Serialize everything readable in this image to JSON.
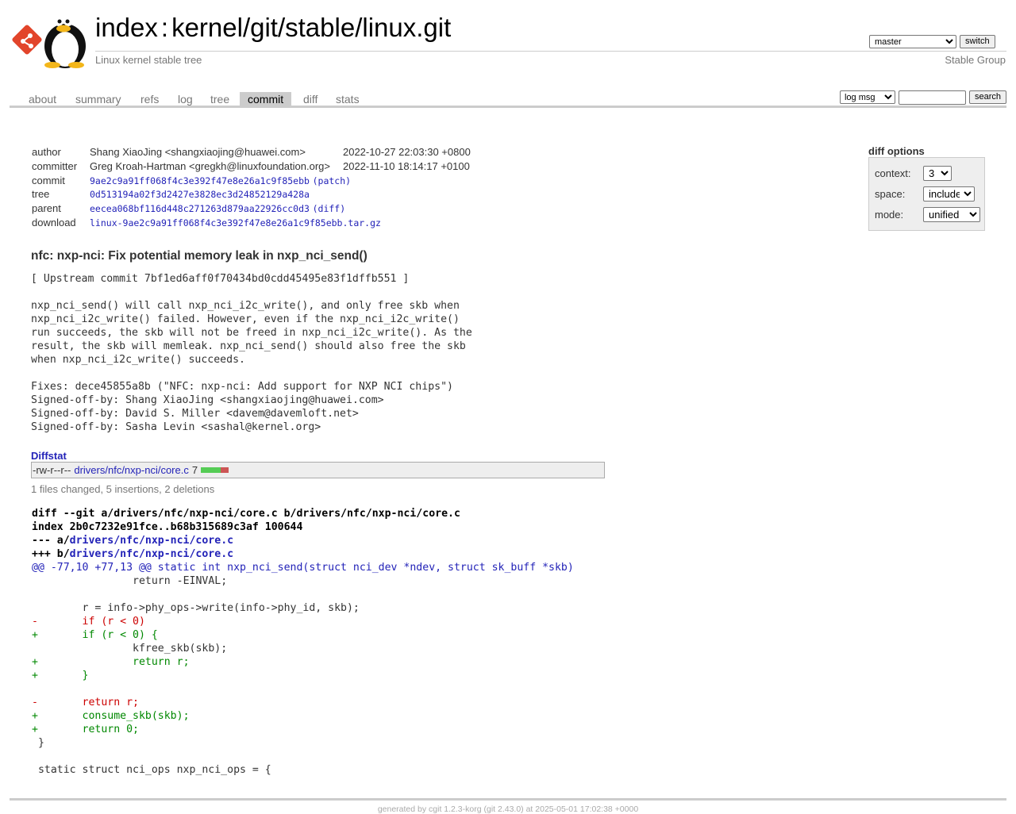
{
  "header": {
    "title_index": "index",
    "title_sep": ":",
    "title_repo": "kernel/git/stable/linux.git",
    "subtitle": "Linux kernel stable tree",
    "owner": "Stable Group",
    "branch_selected": "master",
    "switch_label": "switch"
  },
  "tabs": [
    {
      "label": "about"
    },
    {
      "label": "summary"
    },
    {
      "label": "refs"
    },
    {
      "label": "log"
    },
    {
      "label": "tree"
    },
    {
      "label": "commit",
      "active": true
    },
    {
      "label": "diff"
    },
    {
      "label": "stats"
    }
  ],
  "search": {
    "scope_selected": "log msg",
    "query": "",
    "button_label": "search"
  },
  "commit_info": {
    "author": {
      "label": "author",
      "name": "Shang XiaoJing <shangxiaojing@huawei.com>",
      "date": "2022-10-27 22:03:30 +0800"
    },
    "committer": {
      "label": "committer",
      "name": "Greg Kroah-Hartman <gregkh@linuxfoundation.org>",
      "date": "2022-11-10 18:14:17 +0100"
    },
    "commit": {
      "label": "commit",
      "hash": "9ae2c9a91ff068f4c3e392f47e8e26a1c9f85ebb",
      "extra_link": "patch"
    },
    "tree": {
      "label": "tree",
      "hash": "0d513194a02f3d2427e3828ec3d24852129a428a"
    },
    "parent": {
      "label": "parent",
      "hash": "eecea068bf116d448c271263d879aa22926cc0d3",
      "extra_link": "diff"
    },
    "download": {
      "label": "download",
      "file": "linux-9ae2c9a91ff068f4c3e392f47e8e26a1c9f85ebb.tar.gz"
    }
  },
  "diff_options": {
    "title": "diff options",
    "context_label": "context:",
    "context_value": "3",
    "space_label": "space:",
    "space_value": "include",
    "mode_label": "mode:",
    "mode_value": "unified"
  },
  "commit_subject": "nfc: nxp-nci: Fix potential memory leak in nxp_nci_send()",
  "commit_message": "[ Upstream commit 7bf1ed6aff0f70434bd0cdd45495e83f1dffb551 ]\n\nnxp_nci_send() will call nxp_nci_i2c_write(), and only free skb when\nnxp_nci_i2c_write() failed. However, even if the nxp_nci_i2c_write()\nrun succeeds, the skb will not be freed in nxp_nci_i2c_write(). As the\nresult, the skb will memleak. nxp_nci_send() should also free the skb\nwhen nxp_nci_i2c_write() succeeds.\n\nFixes: dece45855a8b (\"NFC: nxp-nci: Add support for NXP NCI chips\")\nSigned-off-by: Shang XiaoJing <shangxiaojing@huawei.com>\nSigned-off-by: David S. Miller <davem@davemloft.net>\nSigned-off-by: Sasha Levin <sashal@kernel.org>",
  "diffstat": {
    "header": "Diffstat",
    "mode": "-rw-r--r--",
    "file": "drivers/nfc/nxp-nci/core.c",
    "changes": "7",
    "insertions_share": 0.714,
    "add_color": "#55cc55",
    "del_color": "#cc5555",
    "summary": "1 files changed, 5 insertions, 2 deletions"
  },
  "diff": {
    "git_line_prefix": "diff --git a/drivers/nfc/nxp-nci/core.c b/drivers/nfc/nxp-nci/core.c",
    "index_line": "index 2b0c7232e91fce..b68b315689c3af 100644",
    "minus_prefix": "--- a/",
    "plus_prefix": "+++ b/",
    "file_path": "drivers/nfc/nxp-nci/core.c",
    "lines": [
      {
        "type": "hunk",
        "text": "@@ -77,10 +77,13 @@ static int nxp_nci_send(struct nci_dev *ndev, struct sk_buff *skb)"
      },
      {
        "type": "ctx",
        "text": " \t\treturn -EINVAL;"
      },
      {
        "type": "ctx",
        "text": " "
      },
      {
        "type": "ctx",
        "text": " \tr = info->phy_ops->write(info->phy_id, skb);"
      },
      {
        "type": "del",
        "text": "-\tif (r < 0)"
      },
      {
        "type": "add",
        "text": "+\tif (r < 0) {"
      },
      {
        "type": "ctx",
        "text": " \t\tkfree_skb(skb);"
      },
      {
        "type": "add",
        "text": "+\t\treturn r;"
      },
      {
        "type": "add",
        "text": "+\t}"
      },
      {
        "type": "ctx",
        "text": " "
      },
      {
        "type": "del",
        "text": "-\treturn r;"
      },
      {
        "type": "add",
        "text": "+\tconsume_skb(skb);"
      },
      {
        "type": "add",
        "text": "+\treturn 0;"
      },
      {
        "type": "ctx",
        "text": " }"
      },
      {
        "type": "ctx",
        "text": " "
      },
      {
        "type": "ctx",
        "text": " static struct nci_ops nxp_nci_ops = {"
      }
    ]
  },
  "footer": "generated by cgit 1.2.3-korg (git 2.43.0) at 2025-05-01 17:02:38 +0000",
  "icons": {
    "git_logo": "git-logo-icon",
    "tux": "tux-penguin-icon"
  }
}
